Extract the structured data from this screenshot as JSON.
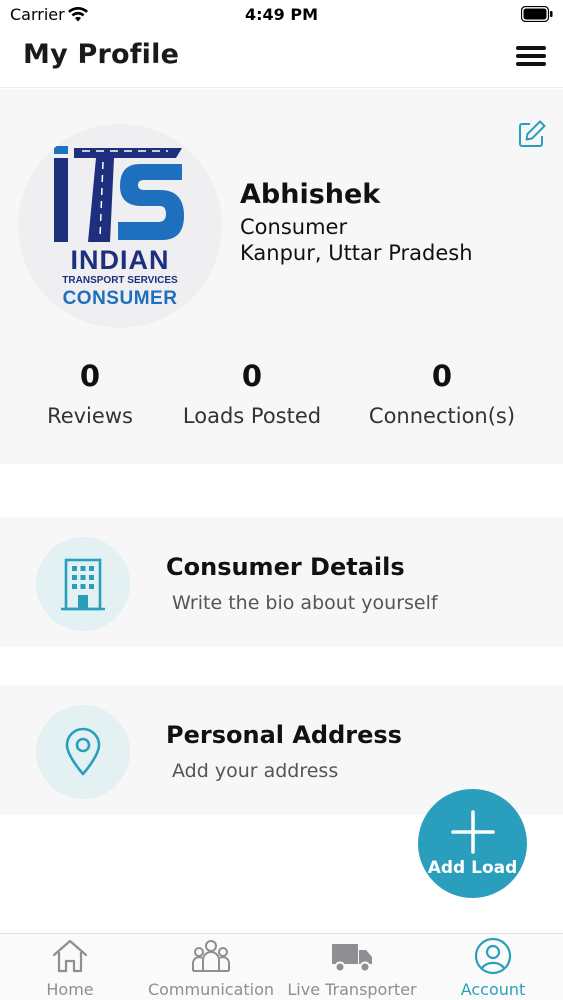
{
  "status_bar": {
    "carrier": "Carrier",
    "time": "4:49 PM"
  },
  "header": {
    "title": "My Profile"
  },
  "profile": {
    "logo": {
      "line1": "INDIAN",
      "line2": "TRANSPORT SERVICES",
      "line3": "CONSUMER"
    },
    "name": "Abhishek",
    "role": "Consumer",
    "location": "Kanpur, Uttar Pradesh",
    "stats": [
      {
        "value": "0",
        "label": "Reviews"
      },
      {
        "value": "0",
        "label": "Loads Posted"
      },
      {
        "value": "0",
        "label": "Connection(s)"
      }
    ]
  },
  "sections": [
    {
      "title": "Consumer Details",
      "subtitle": "Write the bio about yourself",
      "icon": "building-icon"
    },
    {
      "title": "Personal Address",
      "subtitle": "Add your address",
      "icon": "location-pin-icon"
    }
  ],
  "fab": {
    "label": "Add Load"
  },
  "tab_bar": {
    "items": [
      {
        "label": "Home",
        "icon": "home-icon"
      },
      {
        "label": "Communication",
        "icon": "people-icon"
      },
      {
        "label": "Live Transporter",
        "icon": "truck-icon"
      },
      {
        "label": "Account",
        "icon": "account-icon"
      }
    ],
    "active": "Account"
  },
  "colors": {
    "accent": "#2a9fbd",
    "icon_bg": "#e3f1f3",
    "logo_navy": "#1d2f7d",
    "logo_blue": "#1f6fbf"
  }
}
